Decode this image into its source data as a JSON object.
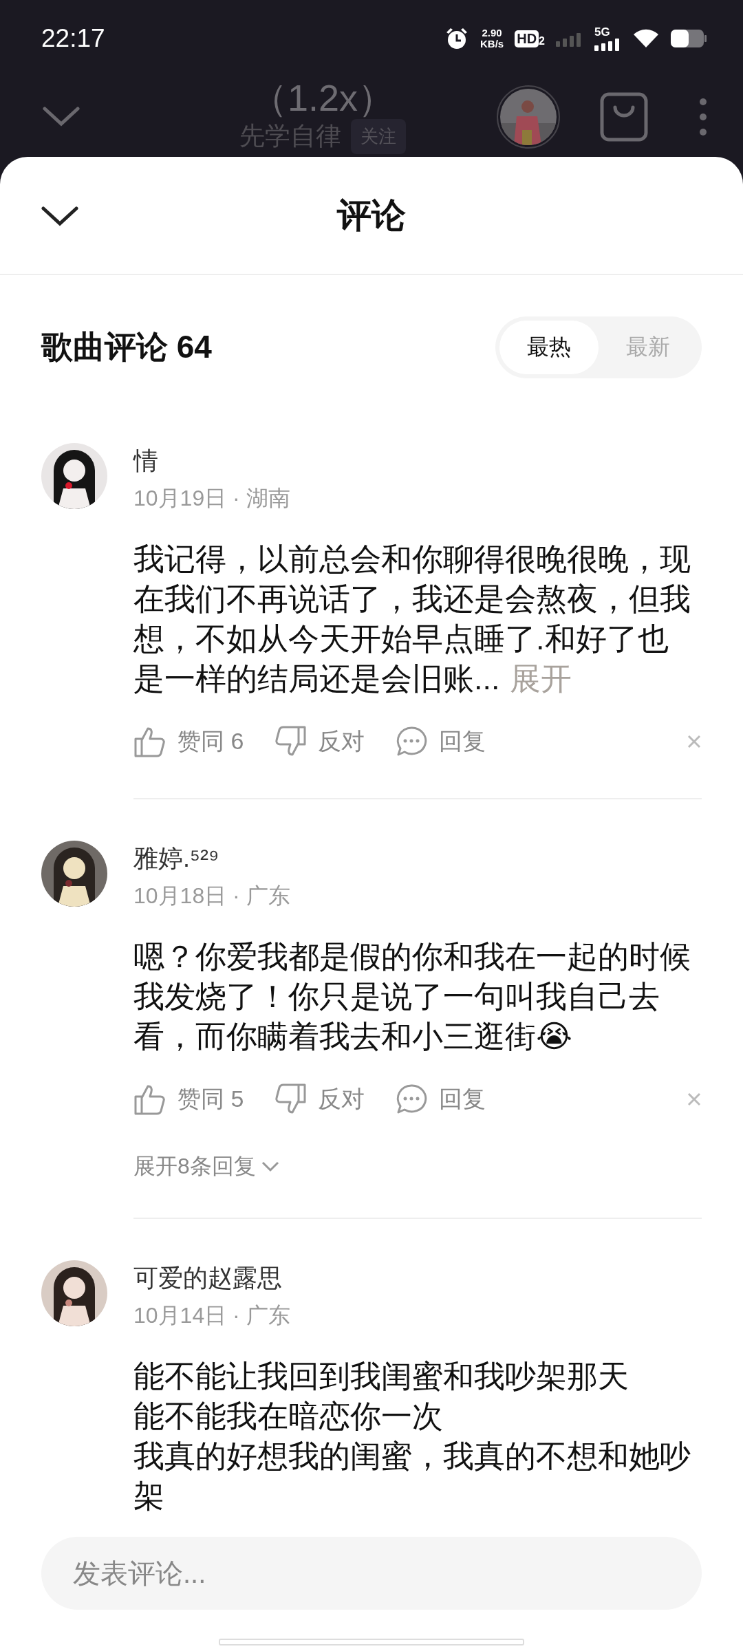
{
  "status_bar": {
    "time": "22:17",
    "net_speed": "2.90",
    "net_unit": "KB/s",
    "hd": "HD",
    "hd_sub": "2",
    "network": "5G"
  },
  "player": {
    "speed": "（1.2x）",
    "artist": "先学自律",
    "follow": "关注"
  },
  "sheet": {
    "title": "评论"
  },
  "section": {
    "title": "歌曲评论 64",
    "sort": [
      {
        "label": "最热",
        "selected": true
      },
      {
        "label": "最新",
        "selected": false
      }
    ]
  },
  "comments": [
    {
      "user": "情",
      "meta": "10月19日 · 湖南",
      "text": "我记得，以前总会和你聊得很晚很晚，现在我们不再说话了，我还是会熬夜，但我想，不如从今天开始早点睡了.和好了也是一样的结局还是会旧账...",
      "more": "展开",
      "likes": "赞同 6",
      "dislike": "反对",
      "reply": "回复"
    },
    {
      "user": "雅婷.⁵²⁹",
      "meta": "10月18日 · 广东",
      "text": "嗯？你爱我都是假的你和我在一起的时候我发烧了！你只是说了一句叫我自己去看，而你瞒着我去和小三逛街😭",
      "likes": "赞同 5",
      "dislike": "反对",
      "reply": "回复",
      "replies": "展开8条回复"
    },
    {
      "user": "可爱的赵露思",
      "meta": "10月14日 · 广东",
      "lines": [
        "能不能让我回到我闺蜜和我吵架那天",
        "能不能我在暗恋你一次",
        "我真的好想我的闺蜜，我真的不想和她吵架"
      ]
    }
  ],
  "composer": {
    "placeholder": "发表评论..."
  }
}
